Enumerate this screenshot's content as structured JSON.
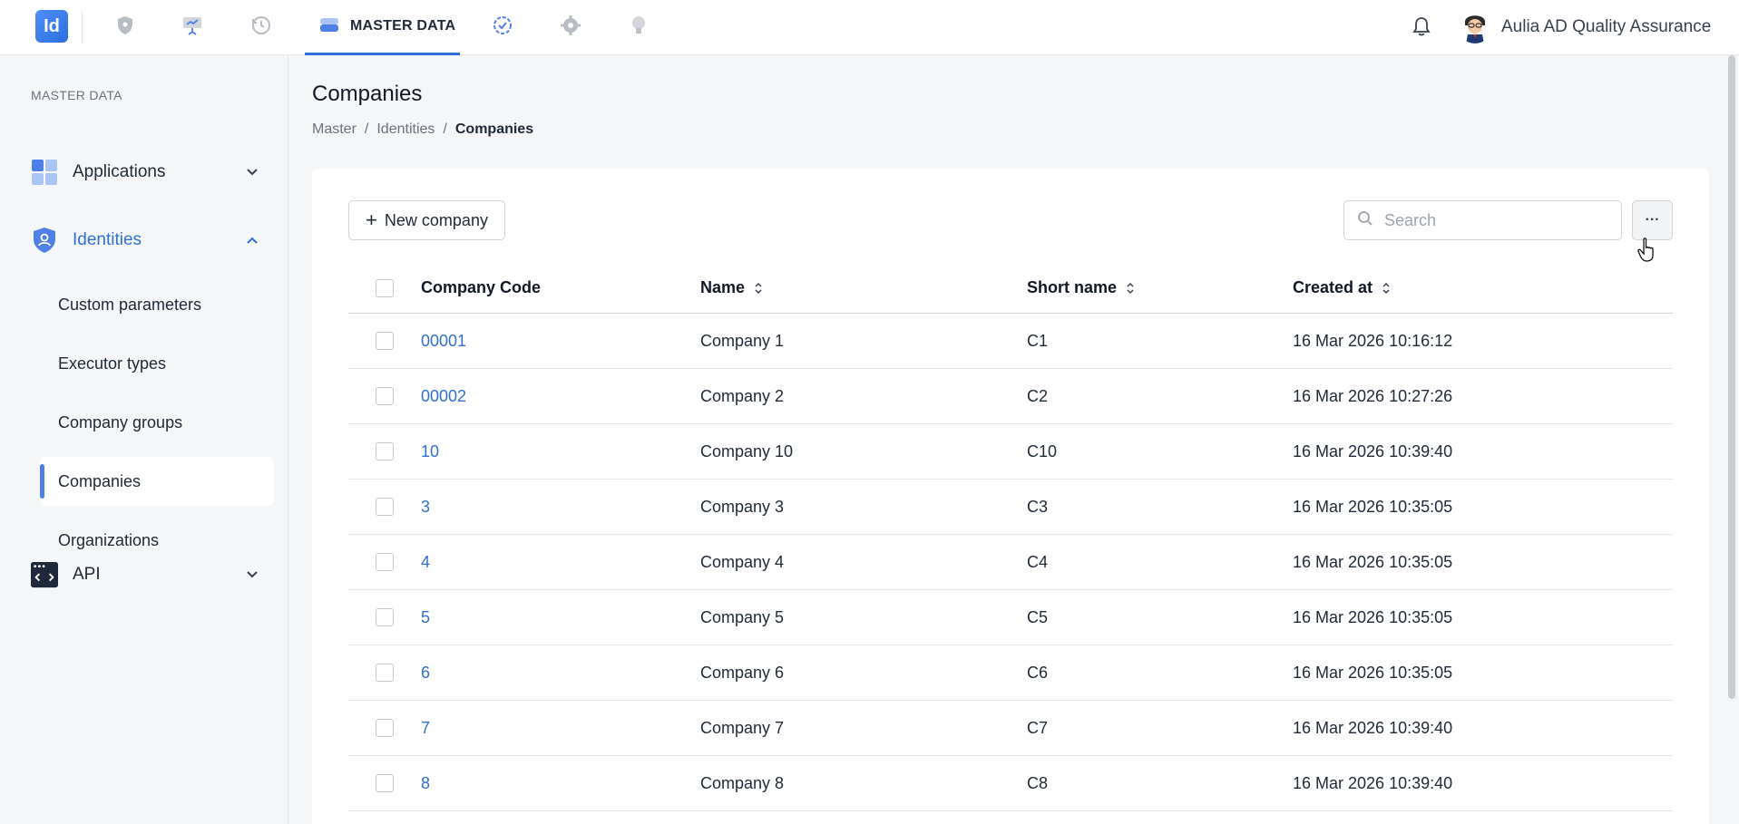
{
  "topbar": {
    "logo_text": "Id",
    "active_tab_label": "MASTER DATA",
    "user_name": "Aulia AD Quality Assurance",
    "nav_icons": [
      "shield-icon",
      "presentation-icon",
      "history-icon",
      "database-icon",
      "badge-check-icon",
      "gear-icon",
      "lightbulb-icon"
    ]
  },
  "sidebar": {
    "heading": "MASTER DATA",
    "groups": {
      "applications": {
        "label": "Applications"
      },
      "identities": {
        "label": "Identities"
      },
      "api": {
        "label": "API"
      }
    },
    "identities_items": [
      {
        "label": "Custom parameters"
      },
      {
        "label": "Executor types"
      },
      {
        "label": "Company groups"
      },
      {
        "label": "Companies"
      },
      {
        "label": "Organizations"
      }
    ]
  },
  "page": {
    "title": "Companies",
    "breadcrumb": [
      "Master",
      "Identities",
      "Companies"
    ],
    "breadcrumb_separator": "/"
  },
  "toolbar": {
    "new_button_label": "New company",
    "search_placeholder": "Search",
    "more_label": "···"
  },
  "table": {
    "columns": [
      "Company Code",
      "Name",
      "Short name",
      "Created at"
    ],
    "rows": [
      {
        "code": "00001",
        "name": "Company 1",
        "short": "C1",
        "created": "16 Mar 2026 10:16:12"
      },
      {
        "code": "00002",
        "name": "Company 2",
        "short": "C2",
        "created": "16 Mar 2026 10:27:26"
      },
      {
        "code": "10",
        "name": "Company 10",
        "short": "C10",
        "created": "16 Mar 2026 10:39:40"
      },
      {
        "code": "3",
        "name": "Company 3",
        "short": "C3",
        "created": "16 Mar 2026 10:35:05"
      },
      {
        "code": "4",
        "name": "Company 4",
        "short": "C4",
        "created": "16 Mar 2026 10:35:05"
      },
      {
        "code": "5",
        "name": "Company 5",
        "short": "C5",
        "created": "16 Mar 2026 10:35:05"
      },
      {
        "code": "6",
        "name": "Company 6",
        "short": "C6",
        "created": "16 Mar 2026 10:35:05"
      },
      {
        "code": "7",
        "name": "Company 7",
        "short": "C7",
        "created": "16 Mar 2026 10:39:40"
      },
      {
        "code": "8",
        "name": "Company 8",
        "short": "C8",
        "created": "16 Mar 2026 10:39:40"
      }
    ]
  },
  "colors": {
    "accent": "#2f6fd6",
    "active_indicator": "#4f80e8"
  }
}
